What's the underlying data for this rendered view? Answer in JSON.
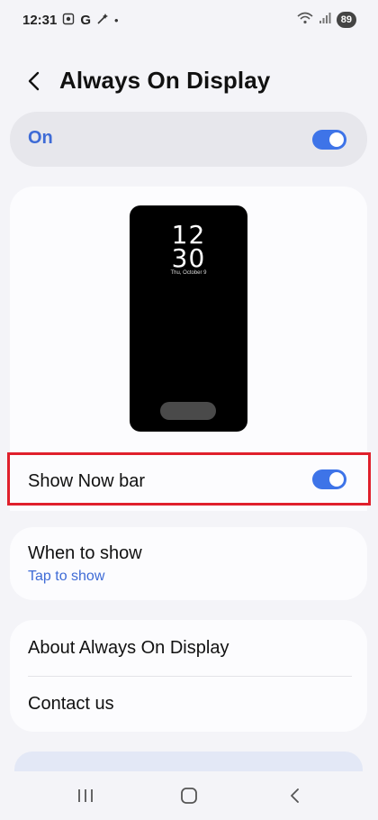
{
  "status_bar": {
    "time": "12:31",
    "g_label": "G",
    "dot": "•",
    "battery": "89"
  },
  "header": {
    "title": "Always On Display"
  },
  "master_switch": {
    "label": "On",
    "enabled": true
  },
  "preview": {
    "hour": "12",
    "minute": "30",
    "date": "Thu, October 9"
  },
  "show_now_bar": {
    "label": "Show Now bar",
    "enabled": true
  },
  "when_to_show": {
    "title": "When to show",
    "value": "Tap to show"
  },
  "about": {
    "items": [
      "About Always On Display",
      "Contact us"
    ]
  },
  "colors": {
    "accent": "#3e6bd6",
    "toggle_on": "#3e74e8",
    "highlight_border": "#e0202c"
  },
  "icons": {
    "back": "chevron-left-icon",
    "nav_recents": "recents-icon",
    "nav_home": "home-icon",
    "nav_back": "back-nav-icon"
  }
}
